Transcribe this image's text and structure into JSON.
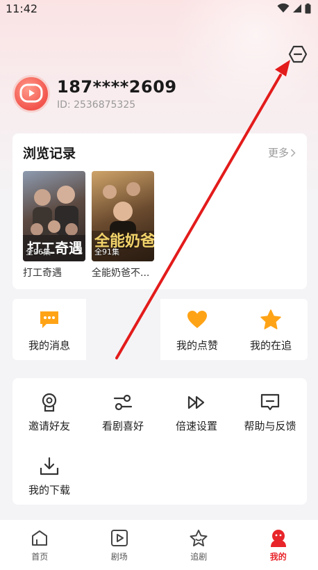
{
  "status_bar": {
    "time": "11:42"
  },
  "profile": {
    "phone": "187****2609",
    "uid": "ID: 2536875325"
  },
  "history": {
    "title": "浏览记录",
    "more": "更多",
    "items": [
      {
        "name": "打工奇遇",
        "episodes": "全96集",
        "poster_text": "打工奇遇"
      },
      {
        "name": "全能奶爸不...",
        "episodes": "全91集",
        "poster_text": "全能奶爸"
      }
    ]
  },
  "quick": {
    "messages": "我的消息",
    "likes": "我的点赞",
    "following": "我的在追"
  },
  "tools": {
    "invite": "邀请好友",
    "preference": "看剧喜好",
    "speed": "倍速设置",
    "feedback": "帮助与反馈",
    "downloads": "我的下载"
  },
  "tabbar": {
    "home": "首页",
    "theater": "剧场",
    "follow": "追剧",
    "mine": "我的"
  },
  "colors": {
    "accent": "#e8252a",
    "orange": "#ffa316",
    "annotation_arrow": "#e31b1b"
  }
}
